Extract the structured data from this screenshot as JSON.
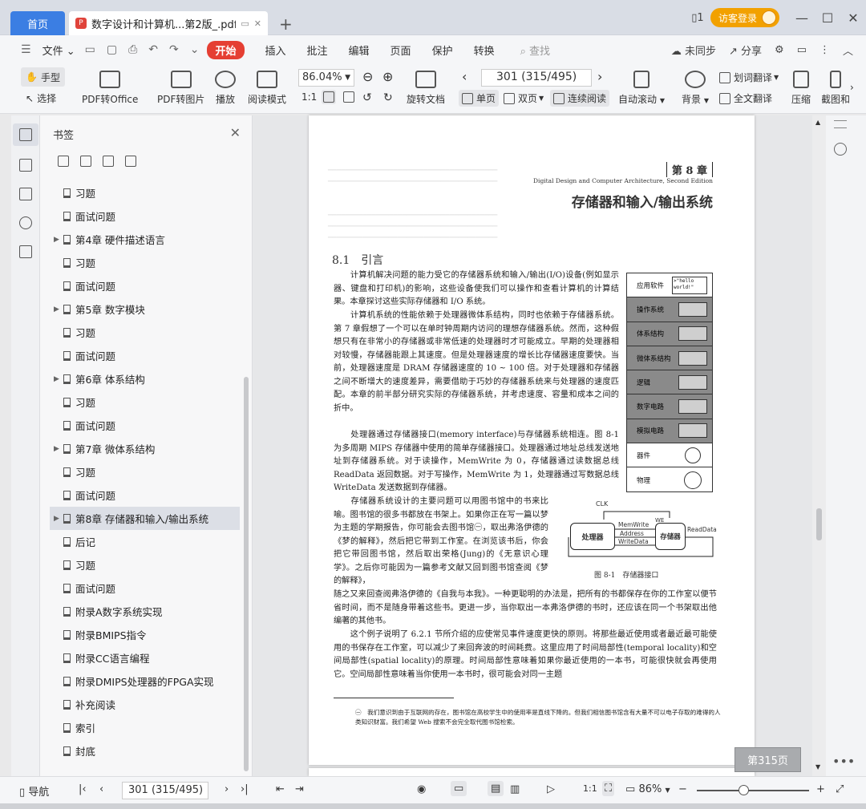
{
  "titlebar": {
    "home_tab": "首页",
    "doc_tab": "数字设计和计算机...第2版_.pdf",
    "login": "访客登录"
  },
  "menu": {
    "file": "文件",
    "start": "开始",
    "items": [
      "插入",
      "批注",
      "编辑",
      "页面",
      "保护",
      "转换"
    ],
    "search": "查找",
    "sync": "未同步",
    "share": "分享"
  },
  "toolbar": {
    "hand": "手型",
    "select": "选择",
    "pdf_to_office": "PDF转Office",
    "pdf_to_image": "PDF转图片",
    "play": "播放",
    "reading_mode": "阅读模式",
    "zoom": "86.04%",
    "page": "301 (315/495)",
    "rotate": "旋转文档",
    "single": "单页",
    "double": "双页",
    "continuous": "连续阅读",
    "autoscroll": "自动滚动",
    "background": "背景",
    "word_translate": "划词翻译",
    "full_translate": "全文翻译",
    "compress": "压缩",
    "screenshot": "截图和"
  },
  "bookmarks": {
    "title": "书签",
    "items": [
      {
        "label": "习题"
      },
      {
        "label": "面试问题"
      },
      {
        "label": "第4章 硬件描述语言"
      },
      {
        "label": "习题"
      },
      {
        "label": "面试问题"
      },
      {
        "label": "第5章 数字模块"
      },
      {
        "label": "习题"
      },
      {
        "label": "面试问题"
      },
      {
        "label": "第6章 体系结构"
      },
      {
        "label": "习题"
      },
      {
        "label": "面试问题"
      },
      {
        "label": "第7章 微体系结构"
      },
      {
        "label": "习题"
      },
      {
        "label": "面试问题"
      },
      {
        "label": "第8章 存储器和输入/输出系统"
      },
      {
        "label": "后记"
      },
      {
        "label": "习题"
      },
      {
        "label": "面试问题"
      },
      {
        "label": "附录A数字系统实现"
      },
      {
        "label": "附录BMIPS指令"
      },
      {
        "label": "附录CC语言编程"
      },
      {
        "label": "附录DMIPS处理器的FPGA实现"
      },
      {
        "label": "补充阅读"
      },
      {
        "label": "索引"
      },
      {
        "label": "封底"
      }
    ]
  },
  "page": {
    "chapter_no": "第 8 章",
    "subtitle": "Digital Design and Computer Architecture, Second Edition",
    "chapter_title": "存储器和输入/输出系统",
    "section": "8.1　引言",
    "p1": "　　计算机解决问题的能力受它的存储器系统和输入/输出(I/O)设备(例如显示器、键盘和打印机)的影响，这些设备使我们可以操作和查看计算机的计算结果。本章探讨这些实际存储器和 I/O 系统。",
    "p2": "　　计算机系统的性能依赖于处理器微体系结构，同时也依赖于存储器系统。第 7 章假想了一个可以在单时钟周期内访问的理想存储器系统。然而，这种假想只有在非常小的存储器或非常低速的处理器时才可能成立。早期的处理器相对较慢，存储器能跟上其速度。但是处理器速度的增长比存储器速度要快。当前，处理器速度是 DRAM 存储器速度的 10 ~ 100 倍。对于处理器和存储器之间不断增大的速度差异，需要借助于巧妙的存储器系统来与处理器的速度匹配。本章的前半部分研究实际的存储器系统，并考虑速度、容量和成本之间的折中。",
    "p3": "　　处理器通过存储器接口(memory interface)与存储器系统相连。图 8-1 为多周期 MIPS 存储器中使用的简单存储器接口。处理器通过地址总线发送地址到存储器系统。对于读操作，MemWrite 为 0，存储器通过读数据总线 ReadData 返回数据。对于写操作，MemWrite 为 1，处理器通过写数据总线 WriteData 发送数据到存储器。",
    "p4": "　　存储器系统设计的主要问题可以用图书馆中的书来比喻。图书馆的很多书都放在书架上。如果你正在写一篇以梦为主题的学期报告，你可能会去图书馆㊀，取出弗洛伊德的《梦的解释》，然后把它带到工作室。在浏览该书后，你会把它带回图书馆，然后取出荣格(Jung)的《无意识心理学》。之后你可能因为一篇参考文献又回到图书馆查阅《梦的解释》，",
    "p5": "随之又来回查阅弗洛伊德的《自我与本我》。一种更聪明的办法是，把所有的书都保存在你的工作室以便节省时间，而不是随身带着这些书。更进一步，当你取出一本弗洛伊德的书时，还应该在同一个书架取出他编著的其他书。",
    "p6": "　　这个例子说明了 6.2.1 节所介绍的应使常见事件速度更快的原则。将那些最近使用或者最近最可能使用的书保存在工作室，可以减少了来回奔波的时间耗费。这里应用了时间局部性(temporal locality)和空间局部性(spatial locality)的原理。时间局部性意味着如果你最近使用的一本书，可能很快就会再使用它。空间局部性意味着当你使用一本书时，很可能会对同一主题",
    "footnote": "㊀　我们意识到由于互联网的存在，图书馆在高校学生中的使用率是直线下降的。但我们相信图书馆含有大量不可以电子存取的难得的人类知识财富。我们希望 Web 搜索不会完全取代图书馆检索。",
    "layers": [
      "应用软件",
      "操作系统",
      "体系结构",
      "微体系结构",
      "逻辑",
      "数字电路",
      "模拟电路",
      "器件",
      "物理"
    ],
    "hello_text": ">\"hello world!\"",
    "fig2": {
      "clk": "CLK",
      "processor": "处理器",
      "memory": "存储器",
      "we": "WE",
      "memwrite": "MemWrite",
      "address": "Address",
      "writedata": "WriteData",
      "readdata": "ReadData",
      "caption": "图 8-1　存储器接口"
    }
  },
  "page_badge": "第315页",
  "status": {
    "nav": "导航",
    "page": "301 (315/495)",
    "zoom": "86%"
  }
}
